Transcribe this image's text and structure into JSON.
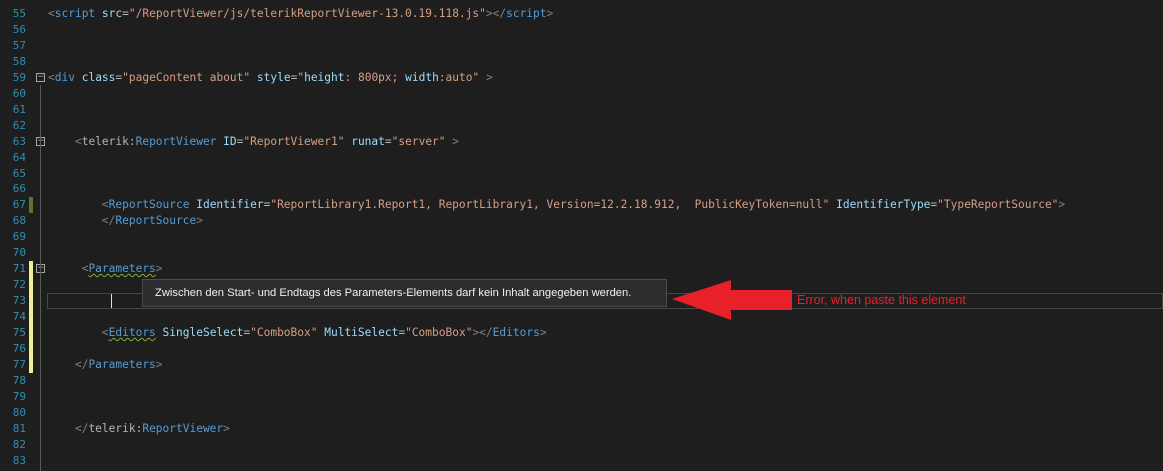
{
  "editor": {
    "lines": [
      {
        "n": "55",
        "segs": [
          {
            "c": "t",
            "t": "<"
          },
          {
            "c": "n",
            "t": "script"
          },
          {
            "c": "p",
            "t": " "
          },
          {
            "c": "a",
            "t": "src"
          },
          {
            "c": "p",
            "t": "="
          },
          {
            "c": "v",
            "t": "\"/ReportViewer/js/telerikReportViewer-13.0.19.118.js\""
          },
          {
            "c": "t",
            "t": "></"
          },
          {
            "c": "n",
            "t": "script"
          },
          {
            "c": "t",
            "t": ">"
          }
        ]
      },
      {
        "n": "56",
        "segs": []
      },
      {
        "n": "57",
        "segs": []
      },
      {
        "n": "58",
        "segs": []
      },
      {
        "n": "59",
        "fold": "−",
        "segs": [
          {
            "c": "t",
            "t": "<"
          },
          {
            "c": "n",
            "t": "div"
          },
          {
            "c": "p",
            "t": " "
          },
          {
            "c": "a",
            "t": "class"
          },
          {
            "c": "p",
            "t": "="
          },
          {
            "c": "v",
            "t": "\"pageContent about\""
          },
          {
            "c": "p",
            "t": " "
          },
          {
            "c": "a",
            "t": "style"
          },
          {
            "c": "p",
            "t": "="
          },
          {
            "c": "v",
            "t": "\""
          },
          {
            "c": "a",
            "t": "height"
          },
          {
            "c": "v",
            "t": ": 800px; "
          },
          {
            "c": "a",
            "t": "width"
          },
          {
            "c": "v",
            "t": ":auto\""
          },
          {
            "c": "p",
            "t": " "
          },
          {
            "c": "t",
            "t": ">"
          }
        ]
      },
      {
        "n": "60",
        "segs": []
      },
      {
        "n": "61",
        "segs": []
      },
      {
        "n": "62",
        "segs": []
      },
      {
        "n": "63",
        "fold": "−",
        "segs": [
          {
            "c": "p",
            "t": "    "
          },
          {
            "c": "t",
            "t": "<"
          },
          {
            "c": "p",
            "t": "telerik:"
          },
          {
            "c": "n",
            "t": "ReportViewer"
          },
          {
            "c": "p",
            "t": " "
          },
          {
            "c": "a",
            "t": "ID"
          },
          {
            "c": "p",
            "t": "="
          },
          {
            "c": "v",
            "t": "\"ReportViewer1\""
          },
          {
            "c": "p",
            "t": " "
          },
          {
            "c": "a",
            "t": "runat"
          },
          {
            "c": "p",
            "t": "="
          },
          {
            "c": "v",
            "t": "\"server\""
          },
          {
            "c": "p",
            "t": " "
          },
          {
            "c": "t",
            "t": ">"
          }
        ]
      },
      {
        "n": "64",
        "segs": []
      },
      {
        "n": "65",
        "segs": []
      },
      {
        "n": "66",
        "segs": []
      },
      {
        "n": "67",
        "segs": [
          {
            "c": "p",
            "t": "        "
          },
          {
            "c": "t",
            "t": "<"
          },
          {
            "c": "n",
            "t": "ReportSource"
          },
          {
            "c": "p",
            "t": " "
          },
          {
            "c": "a",
            "t": "Identifier"
          },
          {
            "c": "p",
            "t": "="
          },
          {
            "c": "v",
            "t": "\"ReportLibrary1.Report1, ReportLibrary1, Version=12.2.18.912,  PublicKeyToken=null\""
          },
          {
            "c": "p",
            "t": " "
          },
          {
            "c": "a",
            "t": "IdentifierType"
          },
          {
            "c": "p",
            "t": "="
          },
          {
            "c": "v",
            "t": "\"TypeReportSource\""
          },
          {
            "c": "t",
            "t": ">"
          }
        ]
      },
      {
        "n": "68",
        "segs": [
          {
            "c": "p",
            "t": "        "
          },
          {
            "c": "t",
            "t": "</"
          },
          {
            "c": "n",
            "t": "ReportSource"
          },
          {
            "c": "t",
            "t": ">"
          }
        ]
      },
      {
        "n": "69",
        "segs": []
      },
      {
        "n": "70",
        "segs": []
      },
      {
        "n": "71",
        "fold": "−",
        "segs": [
          {
            "c": "p",
            "t": "     "
          },
          {
            "c": "t",
            "t": "<"
          },
          {
            "c": "n squig",
            "t": "Parameters"
          },
          {
            "c": "t",
            "t": ">"
          }
        ]
      },
      {
        "n": "72",
        "segs": []
      },
      {
        "n": "73",
        "segs": []
      },
      {
        "n": "74",
        "segs": []
      },
      {
        "n": "75",
        "segs": [
          {
            "c": "p",
            "t": "        "
          },
          {
            "c": "t",
            "t": "<"
          },
          {
            "c": "n squig",
            "t": "Editors"
          },
          {
            "c": "p",
            "t": " "
          },
          {
            "c": "a",
            "t": "SingleSelect"
          },
          {
            "c": "p",
            "t": "="
          },
          {
            "c": "v",
            "t": "\"ComboBox\""
          },
          {
            "c": "p",
            "t": " "
          },
          {
            "c": "a",
            "t": "MultiSelect"
          },
          {
            "c": "p",
            "t": "="
          },
          {
            "c": "v",
            "t": "\"ComboBox\""
          },
          {
            "c": "t",
            "t": "></"
          },
          {
            "c": "n",
            "t": "Editors"
          },
          {
            "c": "t",
            "t": ">"
          }
        ]
      },
      {
        "n": "76",
        "segs": []
      },
      {
        "n": "77",
        "segs": [
          {
            "c": "p",
            "t": "    "
          },
          {
            "c": "t",
            "t": "</"
          },
          {
            "c": "n",
            "t": "Parameters"
          },
          {
            "c": "t",
            "t": ">"
          }
        ]
      },
      {
        "n": "78",
        "segs": []
      },
      {
        "n": "79",
        "segs": []
      },
      {
        "n": "80",
        "segs": []
      },
      {
        "n": "81",
        "segs": [
          {
            "c": "p",
            "t": "    "
          },
          {
            "c": "t",
            "t": "</"
          },
          {
            "c": "p",
            "t": "telerik:"
          },
          {
            "c": "n",
            "t": "ReportViewer"
          },
          {
            "c": "t",
            "t": ">"
          }
        ]
      },
      {
        "n": "82",
        "segs": []
      },
      {
        "n": "83",
        "segs": []
      }
    ]
  },
  "tooltip": {
    "text": "Zwischen den Start- und Endtags des Parameters-Elements darf kein Inhalt angegeben werden."
  },
  "annotation": {
    "text": "Error, when paste this element",
    "color": "#e8202a"
  },
  "colors": {
    "background": "#1e1e1e",
    "line_number": "#2b91af",
    "element": "#569cd6",
    "attribute": "#9cdcfe",
    "value": "#d69d85",
    "change_saved": "#577430",
    "change_unsaved": "#efef91"
  }
}
